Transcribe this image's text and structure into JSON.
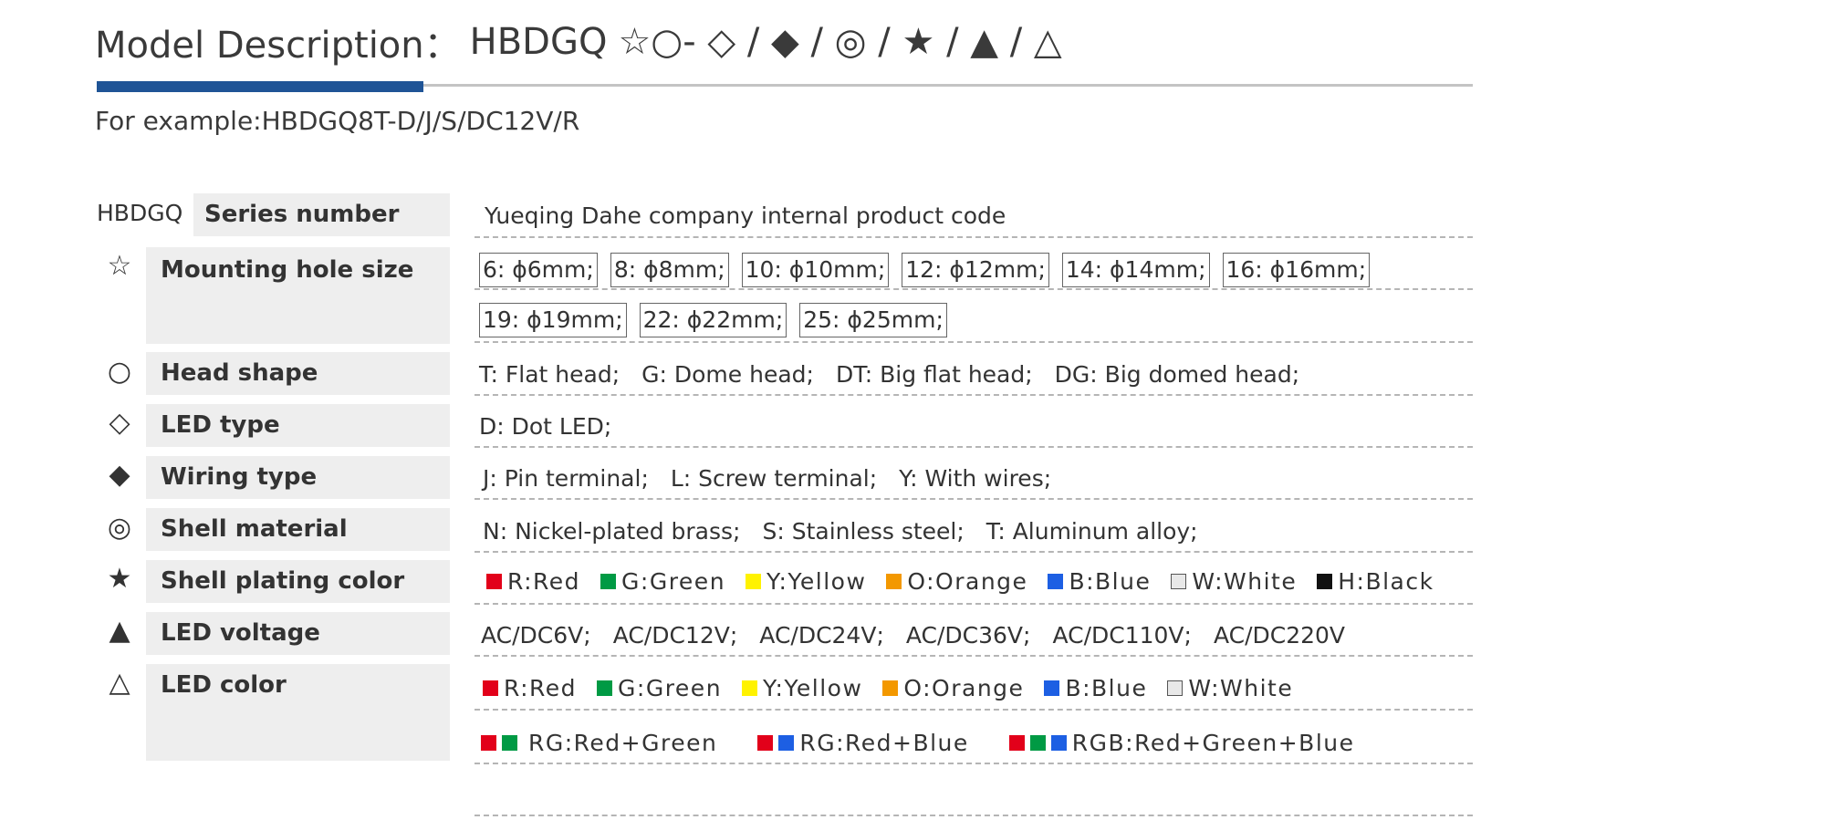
{
  "header": {
    "title_prefix": "Model Description：",
    "model_code": "HBDGQ",
    "symbols": "☆○- ◇ / ◆ / ◎ / ★ / ▲ / △",
    "example": "For example:HBDGQ8T-D/J/S/DC12V/R"
  },
  "colors": {
    "accent_rule": "#1f5496",
    "red": "#e2001a",
    "green": "#009a44",
    "yellow": "#fff200",
    "orange": "#f39800",
    "blue": "#1d5fe3",
    "white": "#e8e8e8",
    "black": "#111111"
  },
  "rows": {
    "series": {
      "symbol": "HBDGQ",
      "label": "Series number",
      "value": "Yueqing Dahe company internal product code"
    },
    "mounting": {
      "symbol": "☆",
      "label": "Mounting hole size",
      "sizes_line1": [
        "6: ϕ6mm;",
        "8: ϕ8mm;",
        "10: ϕ10mm;",
        "12: ϕ12mm;",
        "14: ϕ14mm;",
        "16: ϕ16mm;"
      ],
      "sizes_line2": [
        "19: ϕ19mm;",
        "22: ϕ22mm;",
        "25: ϕ25mm;"
      ]
    },
    "head_shape": {
      "symbol": "○",
      "label": "Head  shape",
      "options": [
        "T: Flat head;",
        "G: Dome head;",
        "DT: Big flat head;",
        "DG: Big domed head;"
      ]
    },
    "led_type": {
      "symbol": "◇",
      "label": "LED type",
      "options": [
        "D: Dot LED;"
      ]
    },
    "wiring": {
      "symbol": "◆",
      "label": "Wiring type",
      "options": [
        "J: Pin terminal;",
        "L: Screw terminal;",
        "Y: With wires;"
      ]
    },
    "shell_material": {
      "symbol": "◎",
      "label": "Shell material",
      "options": [
        "N: Nickel-plated brass;",
        "S: Stainless steel;",
        "T: Aluminum alloy;"
      ]
    },
    "plating_color": {
      "symbol": "★",
      "label": "Shell plating color",
      "options": [
        "R:Red",
        "G:Green",
        "Y:Yellow",
        "O:Orange",
        "B:Blue",
        "W:White",
        "H:Black"
      ]
    },
    "led_voltage": {
      "symbol": "▲",
      "label": "LED voltage",
      "options": [
        "AC/DC6V;",
        "AC/DC12V;",
        "AC/DC24V;",
        "AC/DC36V;",
        "AC/DC110V;",
        "AC/DC220V"
      ]
    },
    "led_color": {
      "symbol": "△",
      "label": "LED color",
      "options_line1": [
        "R:Red",
        "G:Green",
        "Y:Yellow",
        "O:Orange",
        "B:Blue",
        "W:White"
      ],
      "options_line2": [
        "RG:Red+Green",
        "RG:Red+Blue",
        "RGB:Red+Green+Blue"
      ]
    }
  }
}
